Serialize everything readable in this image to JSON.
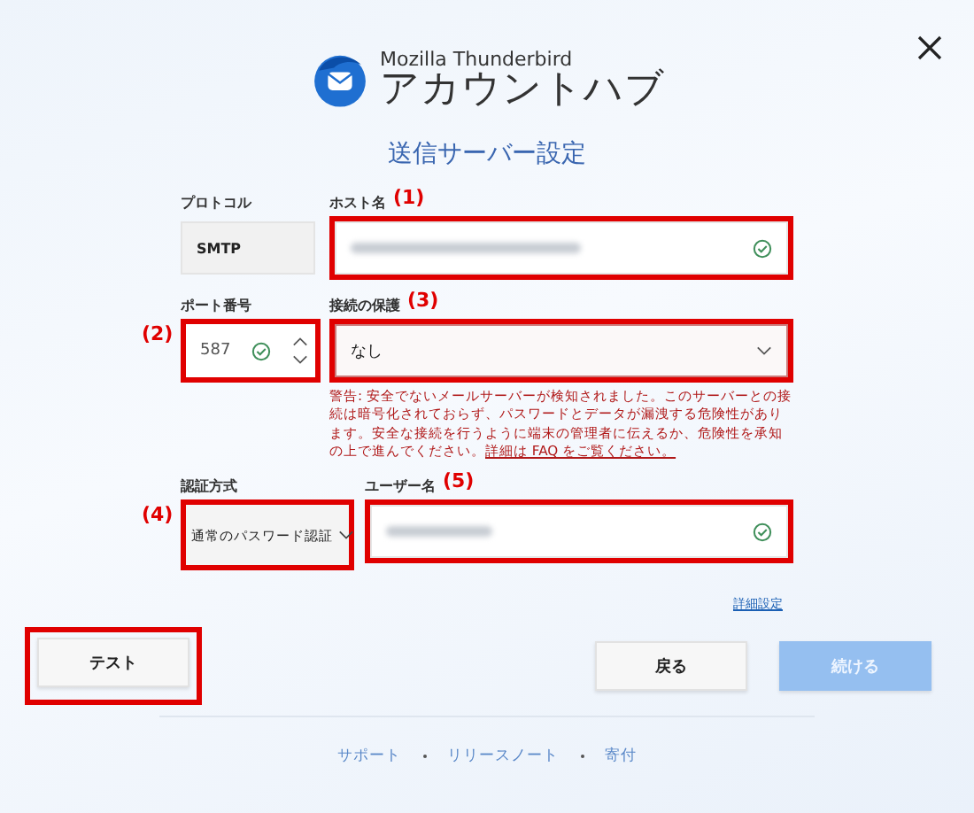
{
  "window": {
    "product": "Mozilla Thunderbird",
    "title": "アカウントハブ"
  },
  "heading": "送信サーバー設定",
  "protocol": {
    "label": "プロトコル",
    "value": "SMTP"
  },
  "hostname": {
    "label": "ホスト名",
    "annotation": "(1)",
    "highlighted": true,
    "valid": true
  },
  "port": {
    "label": "ポート番号",
    "annotation": "(2)",
    "highlighted": true,
    "value": "587",
    "valid": true
  },
  "security": {
    "label": "接続の保護",
    "annotation": "(3)",
    "highlighted": true,
    "value": "なし"
  },
  "warning": {
    "text": "警告: 安全でないメールサーバーが検知されました。このサーバーとの接続は暗号化されておらず、パスワードとデータが漏洩する危険性があります。安全な接続を行うように端末の管理者に伝えるか、危険性を承知の上で進んでください。",
    "link": "詳細は FAQ をご覧ください。"
  },
  "auth": {
    "label": "認証方式",
    "annotation": "(4)",
    "highlighted": true,
    "value": "通常のパスワード認証"
  },
  "username": {
    "label": "ユーザー名",
    "annotation": "(5)",
    "highlighted": true,
    "valid": true
  },
  "advanced_link": "詳細設定",
  "buttons": [
    {
      "label": "テスト",
      "kind": "test",
      "highlighted": true,
      "disabled": false
    },
    {
      "label": "戻る",
      "kind": "back",
      "highlighted": false,
      "disabled": false
    },
    {
      "label": "続ける",
      "kind": "continue",
      "highlighted": false,
      "disabled": true
    }
  ],
  "footer_links": [
    "サポート",
    "リリースノート",
    "寄付"
  ]
}
